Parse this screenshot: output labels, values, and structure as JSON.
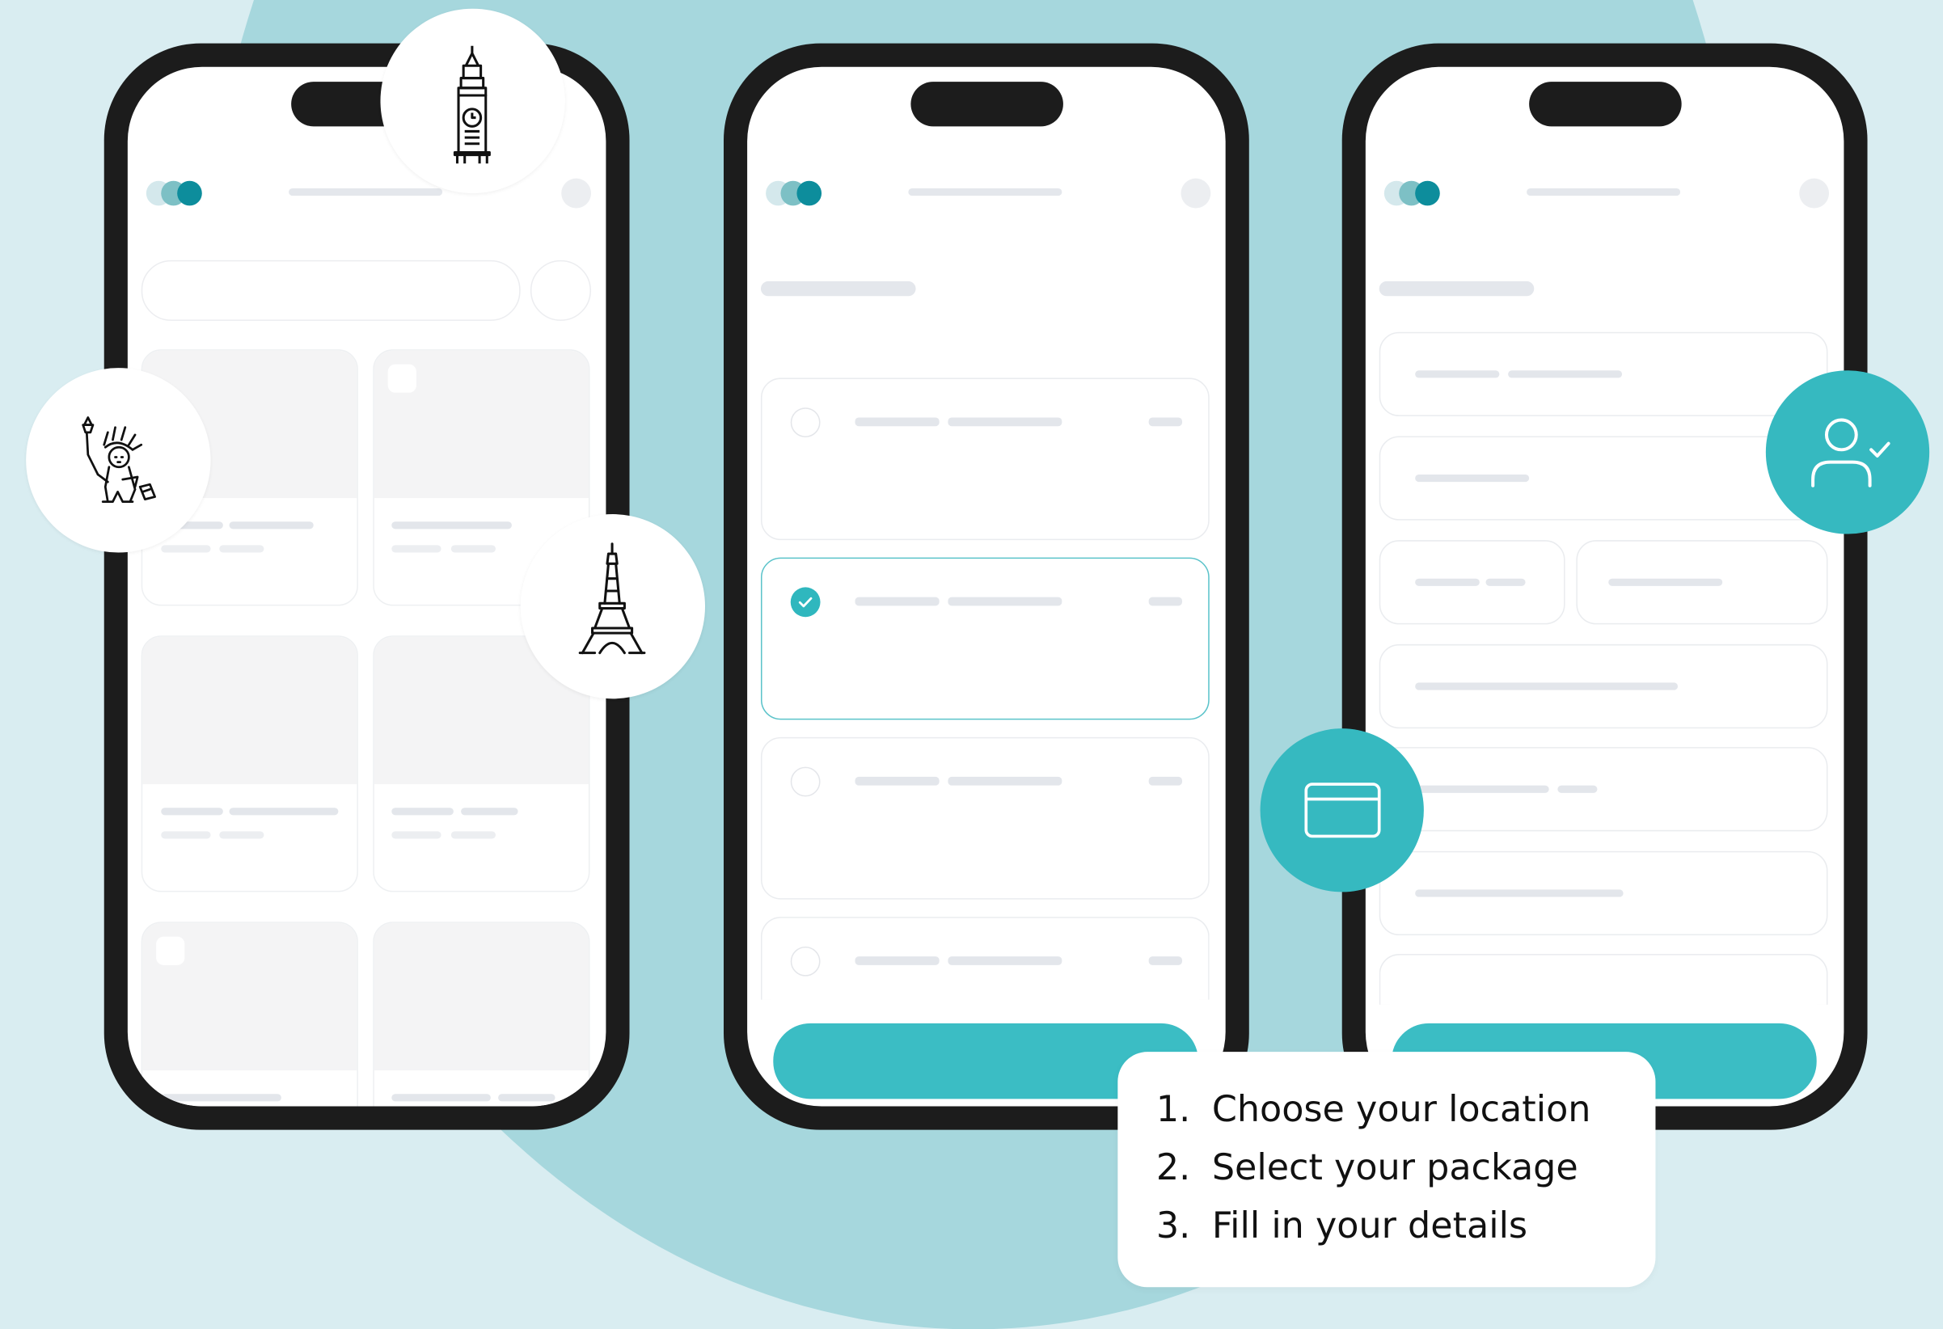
{
  "steps": [
    {
      "number": "1.",
      "text": "Choose your location"
    },
    {
      "number": "2.",
      "text": "Select your package"
    },
    {
      "number": "3.",
      "text": "Fill in your details"
    }
  ],
  "colors": {
    "background": "#d9edf1",
    "circle": "#a6d7dd",
    "accent": "#36b9c0",
    "phone_frame": "#1c1c1c",
    "brand_dots": [
      "#d4e8ec",
      "#7dc0c5",
      "#0d8d9c"
    ]
  },
  "screens": [
    {
      "name": "location-screen",
      "cards": 6
    },
    {
      "name": "package-screen",
      "options": 4,
      "selected_option": 2
    },
    {
      "name": "details-screen",
      "fields": 7
    }
  ],
  "icons": [
    "big-ben-icon",
    "statue-of-liberty-icon",
    "eiffel-tower-icon",
    "credit-card-icon",
    "user-check-icon",
    "checkmark-icon"
  ]
}
